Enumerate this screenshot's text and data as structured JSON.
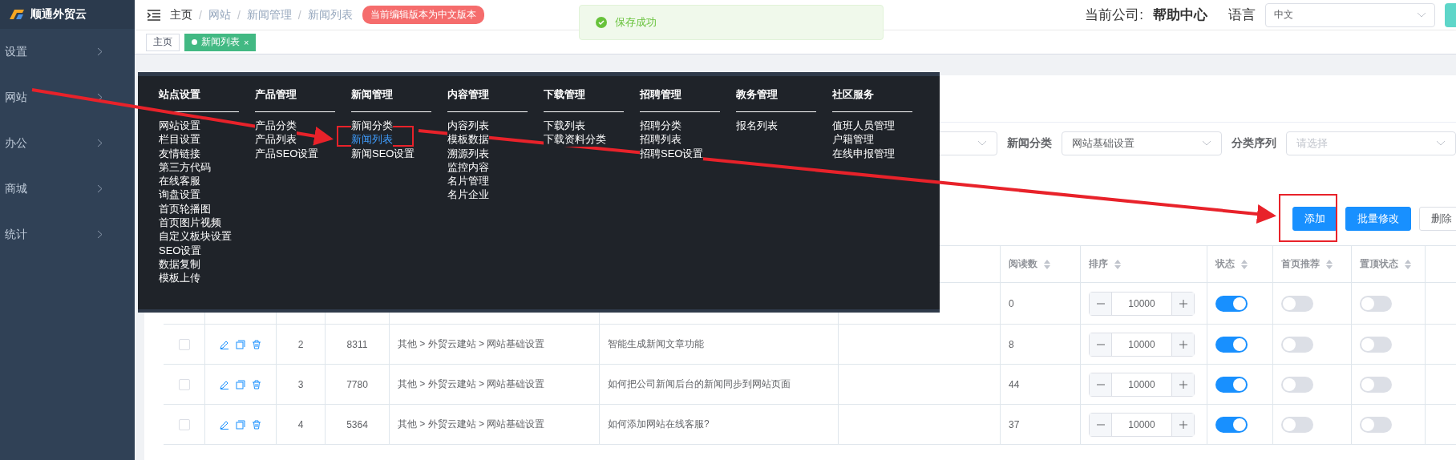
{
  "sidebar": {
    "logo": "顺通外贸云",
    "items": [
      {
        "label": "设置"
      },
      {
        "label": "网站"
      },
      {
        "label": "办公"
      },
      {
        "label": "商城"
      },
      {
        "label": "统计"
      }
    ]
  },
  "header": {
    "breadcrumb": [
      {
        "label": "主页"
      },
      {
        "sep": "/",
        "label": "网站"
      },
      {
        "sep": "/",
        "label": "新闻管理"
      },
      {
        "sep": "/",
        "label": "新闻列表"
      }
    ],
    "version_badge": "当前编辑版本为中文版本",
    "company_label": "当前公司:",
    "company": "帮助中心",
    "language_label": "语言",
    "language": "中文"
  },
  "tags": [
    {
      "label": "主页",
      "selected": false
    },
    {
      "label": "新闻列表",
      "selected": true,
      "close": "×"
    }
  ],
  "toast": {
    "message": "保存成功"
  },
  "filters": [
    {
      "label": "新闻分类",
      "value": "网站基础设置"
    },
    {
      "label": "分类序列",
      "placeholder": "请选择"
    }
  ],
  "actions": [
    {
      "label": "添加",
      "kind": "primary"
    },
    {
      "label": "批量修改",
      "kind": "primary"
    },
    {
      "label": "删除",
      "kind": "plain"
    }
  ],
  "table": {
    "columns": [
      {
        "label": "阅读数"
      },
      {
        "label": "排序"
      },
      {
        "label": "状态"
      },
      {
        "label": "首页推荐"
      },
      {
        "label": "置顶状态"
      }
    ],
    "rows": [
      {
        "views": "0",
        "order": "10000",
        "status": true,
        "home": false,
        "top": false
      },
      {
        "checked": false,
        "index": "2",
        "id": "8311",
        "category": "其他 > 外贸云建站 > 网站基础设置",
        "title": "智能生成新闻文章功能",
        "views": "8",
        "order": "10000",
        "status": true,
        "home": false,
        "top": false
      },
      {
        "checked": false,
        "index": "3",
        "id": "7780",
        "category": "其他 > 外贸云建站 > 网站基础设置",
        "title": "如何把公司新闻后台的新闻同步到网站页面",
        "views": "44",
        "order": "10000",
        "status": true,
        "home": false,
        "top": false
      },
      {
        "checked": false,
        "index": "4",
        "id": "5364",
        "category": "其他 > 外贸云建站 > 网站基础设置",
        "title": "如何添加网站在线客服?",
        "views": "37",
        "order": "10000",
        "status": true,
        "home": false,
        "top": false
      }
    ]
  },
  "mega_menu": {
    "columns": [
      {
        "title": "站点设置",
        "items": [
          {
            "label": "网站设置",
            "selected": false
          },
          {
            "label": "栏目设置",
            "selected": false
          },
          {
            "label": "友情链接",
            "selected": false
          },
          {
            "label": "第三方代码",
            "selected": false
          },
          {
            "label": "在线客服",
            "selected": false
          },
          {
            "label": "询盘设置",
            "selected": false
          },
          {
            "label": "首页轮播图",
            "selected": false
          },
          {
            "label": "首页图片视频",
            "selected": false
          },
          {
            "label": "自定义板块设置",
            "selected": false
          },
          {
            "label": "SEO设置",
            "selected": false
          },
          {
            "label": "数据复制",
            "selected": false
          },
          {
            "label": "模板上传",
            "selected": false
          }
        ]
      },
      {
        "title": "产品管理",
        "items": [
          {
            "label": "产品分类",
            "selected": false
          },
          {
            "label": "产品列表",
            "selected": false
          },
          {
            "label": "产品SEO设置",
            "selected": false
          }
        ]
      },
      {
        "title": "新闻管理",
        "items": [
          {
            "label": "新闻分类",
            "selected": false
          },
          {
            "label": "新闻列表",
            "selected": true
          },
          {
            "label": "新闻SEO设置",
            "selected": false
          }
        ]
      },
      {
        "title": "内容管理",
        "items": [
          {
            "label": "内容列表",
            "selected": false
          },
          {
            "label": "模板数据",
            "selected": false
          },
          {
            "label": "溯源列表",
            "selected": false
          },
          {
            "label": "监控内容",
            "selected": false
          },
          {
            "label": "名片管理",
            "selected": false
          },
          {
            "label": "名片企业",
            "selected": false
          }
        ]
      },
      {
        "title": "下载管理",
        "items": [
          {
            "label": "下载列表",
            "selected": false
          },
          {
            "label": "下载资料分类",
            "selected": false
          }
        ]
      },
      {
        "title": "招聘管理",
        "items": [
          {
            "label": "招聘分类",
            "selected": false
          },
          {
            "label": "招聘列表",
            "selected": false
          },
          {
            "label": "招聘SEO设置",
            "selected": false
          }
        ]
      },
      {
        "title": "教务管理",
        "items": [
          {
            "label": "报名列表",
            "selected": false
          }
        ]
      },
      {
        "title": "社区服务",
        "items": [
          {
            "label": "值班人员管理",
            "selected": false
          },
          {
            "label": "户籍管理",
            "selected": false
          },
          {
            "label": "在线申报管理",
            "selected": false
          }
        ]
      }
    ]
  }
}
